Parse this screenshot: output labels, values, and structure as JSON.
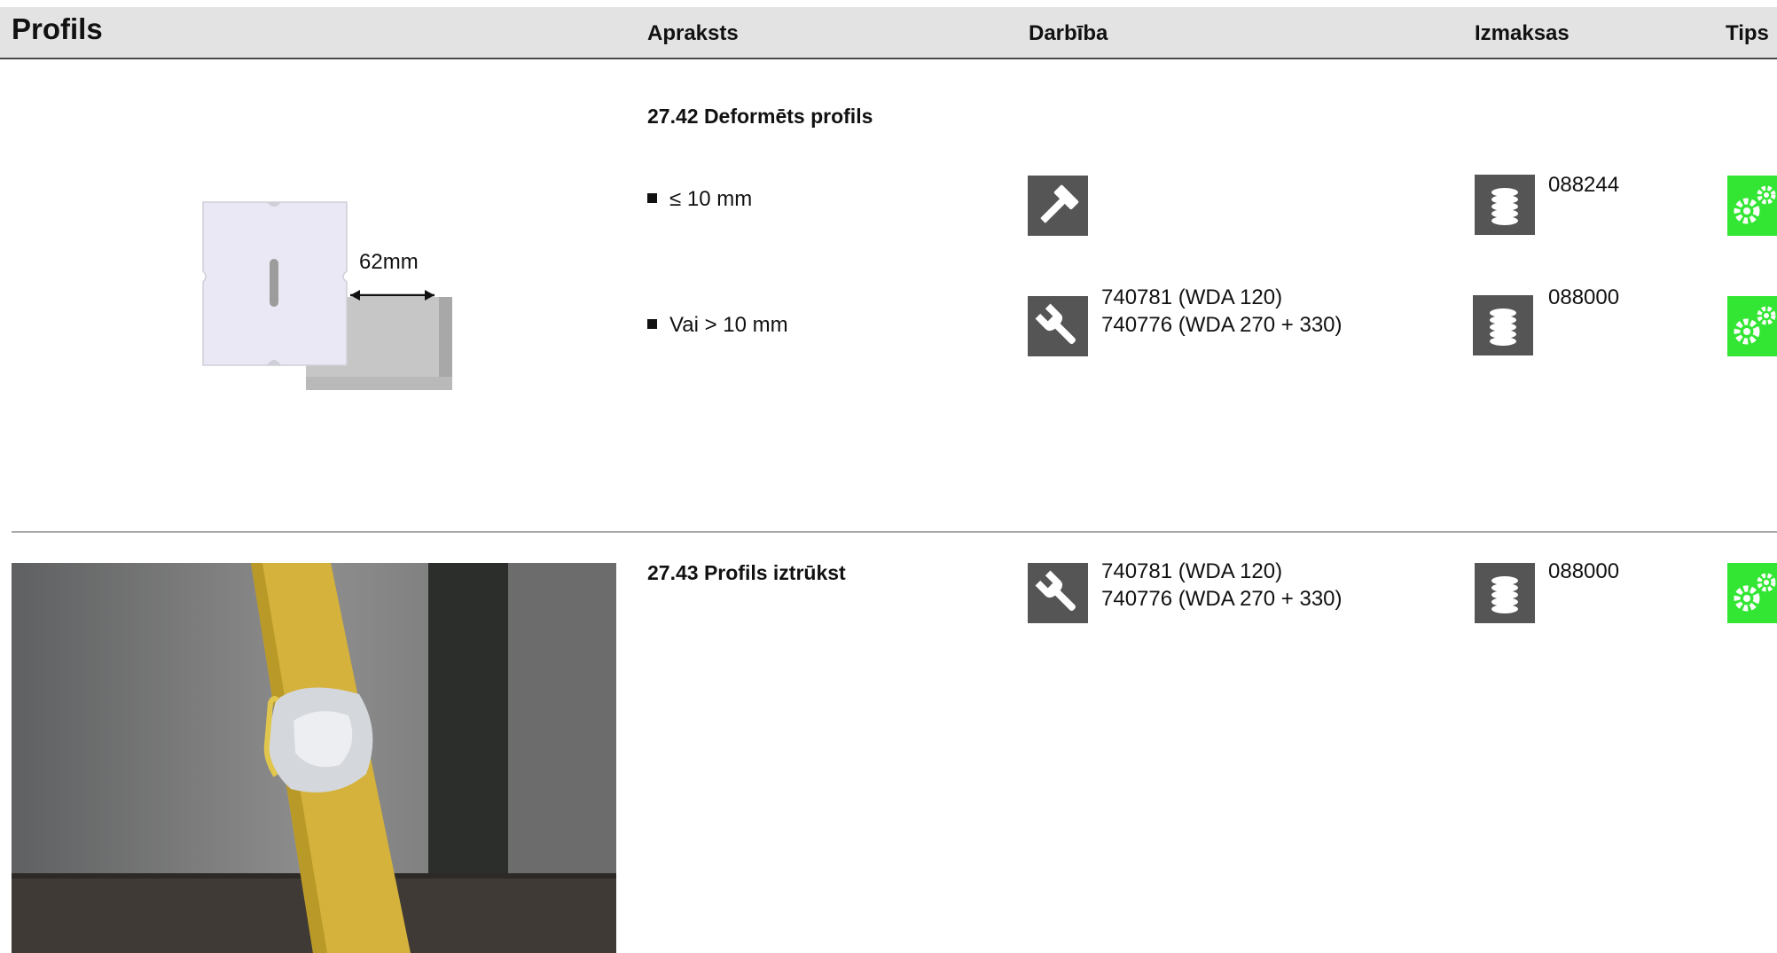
{
  "header": {
    "title": "Profils",
    "col_description": "Apraksts",
    "col_action": "Darbība",
    "col_cost": "Izmaksas",
    "col_tips": "Tips"
  },
  "section1": {
    "title": "27.42 Deformēts profils",
    "diagram_label": "62mm",
    "rows": [
      {
        "description": "≤ 10 mm",
        "action_icon": "hammer-icon",
        "action_lines": [],
        "cost_icon": "coins-icon",
        "cost_code": "088244",
        "tips_icon": "gears-icon"
      },
      {
        "description": "Vai > 10 mm",
        "action_icon": "wrench-icon",
        "action_lines": [
          "740781 (WDA 120)",
          "740776 (WDA 270 + 330)"
        ],
        "cost_icon": "coins-icon",
        "cost_code": "088000",
        "tips_icon": "gears-icon"
      }
    ]
  },
  "section2": {
    "title": "27.43 Profils iztrūkst",
    "action_icon": "wrench-icon",
    "action_lines": [
      "740781 (WDA 120)",
      "740776 (WDA 270 + 330)"
    ],
    "cost_icon": "coins-icon",
    "cost_code": "088000",
    "tips_icon": "gears-icon"
  },
  "colors": {
    "header_bg": "#e3e3e3",
    "icon_bg": "#555555",
    "tips_green": "#33e633",
    "divider": "#a9a9a9"
  }
}
